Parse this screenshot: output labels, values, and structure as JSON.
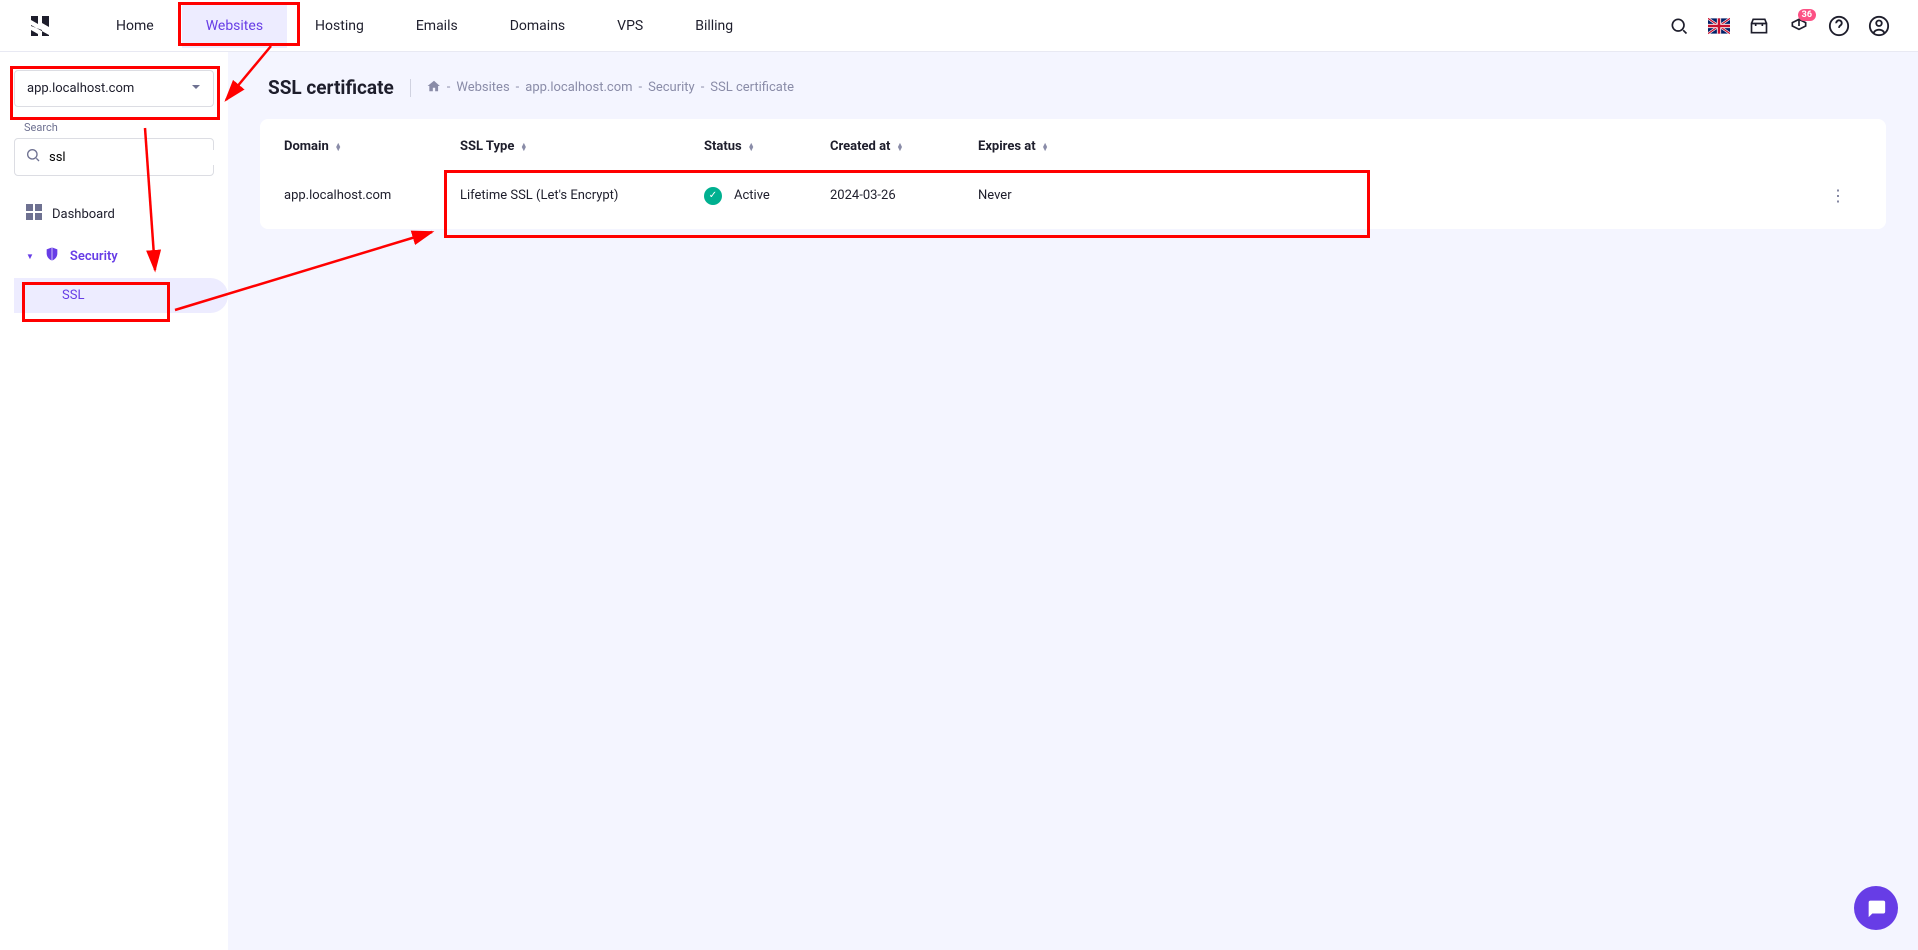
{
  "nav": {
    "links": [
      "Home",
      "Websites",
      "Hosting",
      "Emails",
      "Domains",
      "VPS",
      "Billing"
    ],
    "active_index": 1,
    "notification_count": "36"
  },
  "sidebar": {
    "selected_domain": "app.localhost.com",
    "search_label": "Search",
    "search_value": "ssl",
    "dashboard_label": "Dashboard",
    "security_label": "Security",
    "ssl_label": "SSL"
  },
  "page": {
    "title": "SSL certificate",
    "breadcrumb_parts": [
      "Websites",
      "app.localhost.com",
      "Security",
      "SSL certificate"
    ]
  },
  "table": {
    "headers": {
      "domain": "Domain",
      "ssl_type": "SSL Type",
      "status": "Status",
      "created_at": "Created at",
      "expires_at": "Expires at"
    },
    "rows": [
      {
        "domain": "app.localhost.com",
        "ssl_type": "Lifetime SSL (Let's Encrypt)",
        "status": "Active",
        "created_at": "2024-03-26",
        "expires_at": "Never"
      }
    ]
  }
}
